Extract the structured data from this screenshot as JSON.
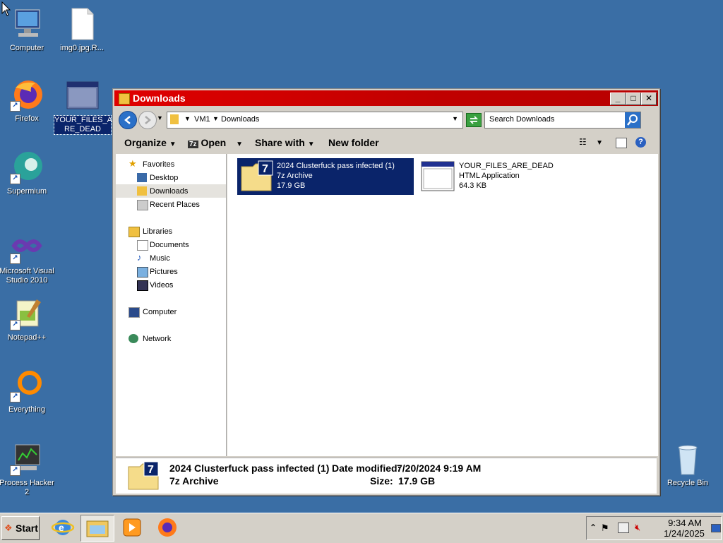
{
  "desktop": {
    "icons": [
      {
        "label": "Computer"
      },
      {
        "label": "img0.jpg.R..."
      },
      {
        "label": "Firefox"
      },
      {
        "label": "YOUR_FILES_A RE_DEAD"
      },
      {
        "label": "Supermium"
      },
      {
        "label": "Microsoft Visual Studio 2010"
      },
      {
        "label": "Notepad++"
      },
      {
        "label": "Everything"
      },
      {
        "label": "Process Hacker 2"
      },
      {
        "label": "Recycle Bin"
      }
    ]
  },
  "window": {
    "title": "Downloads",
    "address": {
      "crumbs": [
        "VM1",
        "Downloads"
      ]
    },
    "search_placeholder": "Search Downloads",
    "toolbar": {
      "organize": "Organize",
      "open": "Open",
      "share_with": "Share with",
      "new_folder": "New folder"
    },
    "nav": {
      "favorites": "Favorites",
      "desktop": "Desktop",
      "downloads": "Downloads",
      "recent_places": "Recent Places",
      "libraries": "Libraries",
      "documents": "Documents",
      "music": "Music",
      "pictures": "Pictures",
      "videos": "Videos",
      "computer": "Computer",
      "network": "Network"
    },
    "files": [
      {
        "name": "2024 Clusterfuck pass infected (1)",
        "type": "7z Archive",
        "size": "17.9 GB"
      },
      {
        "name": "YOUR_FILES_ARE_DEAD",
        "type": "HTML Application",
        "size": "64.3 KB"
      }
    ],
    "details": {
      "name": "2024 Clusterfuck pass infected (1)",
      "date_label": "Date modified:",
      "date_value": "7/20/2024 9:19 AM",
      "type": "7z Archive",
      "size_label": "Size:",
      "size_value": "17.9 GB"
    }
  },
  "taskbar": {
    "start_label": "Start",
    "clock": {
      "time": "9:34 AM",
      "date": "1/24/2025"
    }
  }
}
